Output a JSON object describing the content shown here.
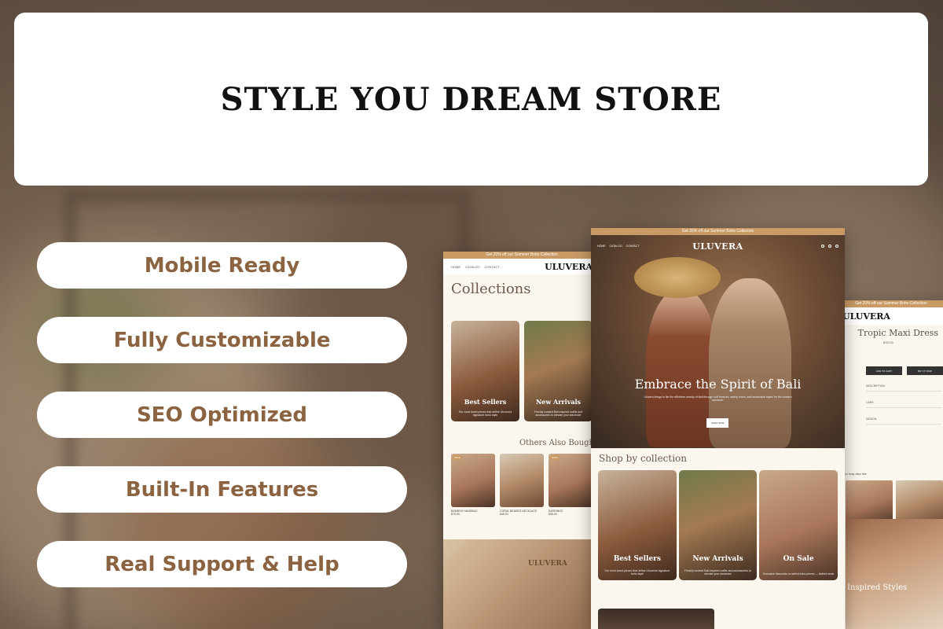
{
  "header": {
    "title": "STYLE YOU DREAM STORE"
  },
  "features": [
    {
      "label": "Mobile Ready"
    },
    {
      "label": "Fully Customizable"
    },
    {
      "label": "SEO Optimized"
    },
    {
      "label": "Built-In Features"
    },
    {
      "label": "Real Support & Help"
    }
  ],
  "mockup": {
    "brand": "ULUVERA",
    "nav_links": [
      "HOME",
      "CATALOG",
      "CONTACT"
    ],
    "collections_title": "Collections",
    "announcement": "Get 20% off our Summer Boho Collection",
    "hero": {
      "headline": "Embrace the Spirit of Bali",
      "subtext": "Uluvera brings to life the effortless beauty of Bali through soft textures, earthy tones, and breathable styles for the modern wanderer.",
      "cta": "SHOP NOW"
    },
    "shop_by_collection": "Shop by collection",
    "cards": [
      {
        "title": "Best Sellers",
        "sub": "Our most loved pieces that define Uluvera's signature boho style"
      },
      {
        "title": "New Arrivals",
        "sub": "Freshly curated Bali-inspired outfits and accessories to elevate your wardrobe"
      },
      {
        "title": "On Sale",
        "sub": "Exclusive discounts on select boho pieces — limited stock"
      }
    ],
    "others_also_bought": "Others Also Bought",
    "products": [
      {
        "name": "BAMBOO HANDBAG",
        "price": "$79.00",
        "tag": "SALE"
      },
      {
        "name": "CORAL BEADED NECKLACE",
        "price": "$45.00",
        "tag": ""
      },
      {
        "name": "EARRINGS",
        "price": "$35.00",
        "tag": "SALE"
      }
    ],
    "product_page": {
      "title": "Tropic Maxi Dress",
      "price": "$120.00",
      "add_to_cart": "ADD TO CART",
      "buy_now": "BUY IT NOW",
      "accordion": [
        "DESCRIPTION",
        "CARE",
        "DESIGN"
      ],
      "also_like": "You may also like",
      "inspired": "Inspired Styles"
    }
  }
}
